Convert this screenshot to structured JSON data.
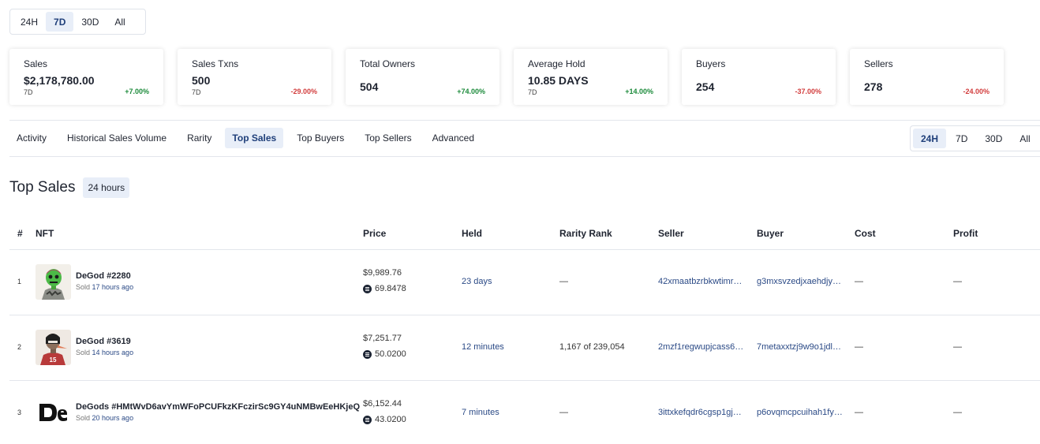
{
  "top_range": {
    "options": [
      "24H",
      "7D",
      "30D",
      "All"
    ],
    "active": "7D"
  },
  "stats": [
    {
      "label": "Sales",
      "value": "$2,178,780.00",
      "period": "7D",
      "change": "+7.00%",
      "dir": "pos"
    },
    {
      "label": "Sales Txns",
      "value": "500",
      "period": "7D",
      "change": "-29.00%",
      "dir": "neg"
    },
    {
      "label": "Total Owners",
      "value": "504",
      "period": "",
      "change": "+74.00%",
      "dir": "pos"
    },
    {
      "label": "Average Hold",
      "value": "10.85 DAYS",
      "period": "7D",
      "change": "+14.00%",
      "dir": "pos"
    },
    {
      "label": "Buyers",
      "value": "254",
      "period": "",
      "change": "-37.00%",
      "dir": "neg"
    },
    {
      "label": "Sellers",
      "value": "278",
      "period": "",
      "change": "-24.00%",
      "dir": "neg"
    }
  ],
  "tabs": [
    "Activity",
    "Historical Sales Volume",
    "Rarity",
    "Top Sales",
    "Top Buyers",
    "Top Sellers",
    "Advanced"
  ],
  "active_tab": "Top Sales",
  "section_range": {
    "options": [
      "24H",
      "7D",
      "30D",
      "All"
    ],
    "active": "24H"
  },
  "section": {
    "title": "Top Sales",
    "period_pill": "24 hours"
  },
  "table": {
    "headers": [
      "#",
      "NFT",
      "Price",
      "Held",
      "Rarity Rank",
      "Seller",
      "Buyer",
      "Cost",
      "Profit"
    ],
    "rows": [
      {
        "idx": "1",
        "name": "DeGod #2280",
        "sold_prefix": "Sold",
        "sold_time": "17 hours ago",
        "usd": "$9,989.76",
        "sol": "69.8478",
        "held": "23 days",
        "rank": "—",
        "seller": "42xmaatbzrbkwtimr…",
        "buyer": "g3mxsvzedjxaehdjy…",
        "cost": "—",
        "profit": "—",
        "thumb": "degod-green-skull"
      },
      {
        "idx": "2",
        "name": "DeGod #3619",
        "sold_prefix": "Sold",
        "sold_time": "14 hours ago",
        "usd": "$7,251.77",
        "sol": "50.0200",
        "held": "12 minutes",
        "rank": "1,167 of 239,054",
        "seller": "2mzf1regwupjcass6…",
        "buyer": "7metaxxtzj9w9o1jdl…",
        "cost": "—",
        "profit": "—",
        "thumb": "degod-red-jersey"
      },
      {
        "idx": "3",
        "name": "DeGods #HMtWvD6avYmWFoPCUFkzKFczirSc9GY4uNMBwEeHKjeQ",
        "sold_prefix": "Sold",
        "sold_time": "20 hours ago",
        "usd": "$6,152.44",
        "sol": "43.0200",
        "held": "7 minutes",
        "rank": "—",
        "seller": "3ittxkefqdr6cgsp1gj…",
        "buyer": "p6ovqmcpcuihah1fy…",
        "cost": "—",
        "profit": "—",
        "thumb": "degods-logo"
      }
    ]
  },
  "colors": {
    "accent_bg": "#e8eef8",
    "link": "#2b4a86",
    "positive": "#1b8a3a",
    "negative": "#d23c3c"
  }
}
